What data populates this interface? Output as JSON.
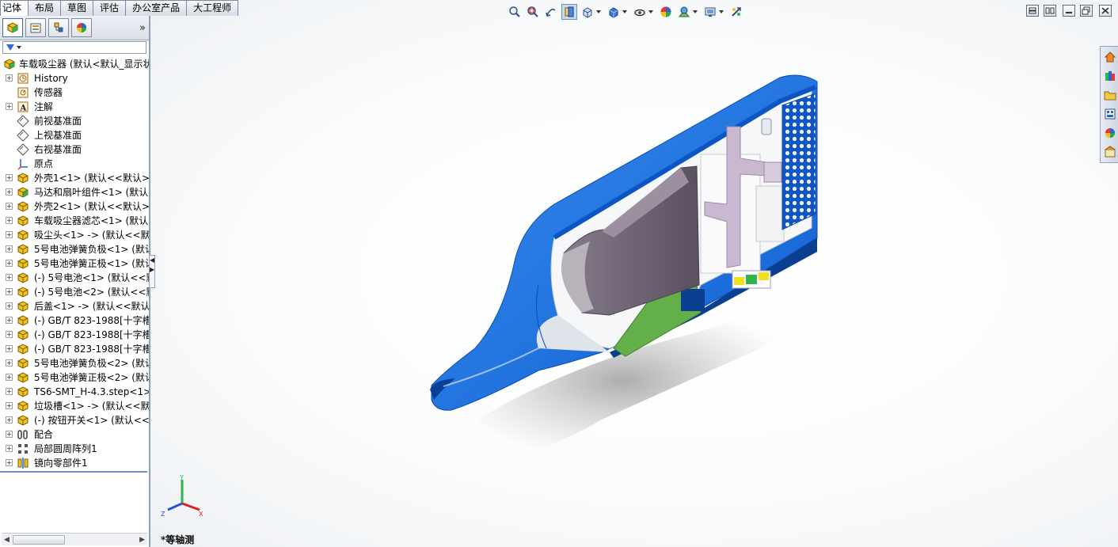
{
  "command_tabs": [
    {
      "label": "记体",
      "active": true
    },
    {
      "label": "布局",
      "active": false
    },
    {
      "label": "草图",
      "active": false
    },
    {
      "label": "评估",
      "active": false
    },
    {
      "label": "办公室产品",
      "active": false
    },
    {
      "label": "大工程师",
      "active": false
    }
  ],
  "panel": {
    "tabs": [
      "featuremanager-icon",
      "propertymanager-icon",
      "configurationmanager-icon",
      "displaymanager-icon"
    ],
    "expand_glyph": "»",
    "tree": [
      {
        "label": "车载吸尘器  (默认<默认_显示状",
        "icon": "assembly-icon",
        "top": true
      },
      {
        "label": "History",
        "icon": "history-icon",
        "expand": true
      },
      {
        "label": "传感器",
        "icon": "sensor-icon",
        "expand": false
      },
      {
        "label": "注解",
        "icon": "annotation-icon",
        "expand": true
      },
      {
        "label": "前视基准面",
        "icon": "plane-icon",
        "expand": false
      },
      {
        "label": "上视基准面",
        "icon": "plane-icon",
        "expand": false
      },
      {
        "label": "右视基准面",
        "icon": "plane-icon",
        "expand": false
      },
      {
        "label": "原点",
        "icon": "origin-icon",
        "expand": false
      },
      {
        "label": "外壳1<1> (默认<<默认>_",
        "icon": "part-icon",
        "expand": true
      },
      {
        "label": "马达和扇叶组件<1> (默认<",
        "icon": "subassembly-icon",
        "expand": true
      },
      {
        "label": "外壳2<1> (默认<<默认>_",
        "icon": "part-icon",
        "expand": true
      },
      {
        "label": "车载吸尘器滤芯<1> (默认<",
        "icon": "part-icon",
        "expand": true
      },
      {
        "label": "吸尘头<1> -> (默认<<默认",
        "icon": "part-icon",
        "expand": true
      },
      {
        "label": "5号电池弹簧负极<1> (默认",
        "icon": "part-icon",
        "expand": true
      },
      {
        "label": "5号电池弹簧正极<1> (默认",
        "icon": "part-icon",
        "expand": true
      },
      {
        "label": "(-) 5号电池<1> (默认<<默",
        "icon": "part-icon",
        "expand": true
      },
      {
        "label": "(-) 5号电池<2> (默认<<默",
        "icon": "part-icon",
        "expand": true
      },
      {
        "label": "后盖<1> -> (默认<<默认>",
        "icon": "part-icon",
        "expand": true
      },
      {
        "label": "(-) GB/T 823-1988[十字槽",
        "icon": "part-icon",
        "expand": true
      },
      {
        "label": "(-) GB/T 823-1988[十字槽",
        "icon": "part-icon",
        "expand": true
      },
      {
        "label": "(-) GB/T 823-1988[十字槽",
        "icon": "part-icon",
        "expand": true
      },
      {
        "label": "5号电池弹簧负极<2> (默认",
        "icon": "part-icon",
        "expand": true
      },
      {
        "label": "5号电池弹簧正极<2> (默认",
        "icon": "part-icon",
        "expand": true
      },
      {
        "label": "TS6-SMT_H-4.3.step<1>",
        "icon": "part-icon",
        "expand": true
      },
      {
        "label": "垃圾槽<1> -> (默认<<默认",
        "icon": "part-icon",
        "expand": true
      },
      {
        "label": "(-) 按钮开关<1> (默认<<默",
        "icon": "part-icon",
        "expand": true
      },
      {
        "label": "配合",
        "icon": "mates-icon",
        "expand": true
      },
      {
        "label": "局部圆周阵列1",
        "icon": "circular-pattern-icon",
        "expand": true
      },
      {
        "label": "镜向零部件1",
        "icon": "mirror-icon",
        "expand": true
      }
    ]
  },
  "hud_toolbar": [
    {
      "icon": "zoom-to-fit-icon",
      "dropdown": false,
      "active": false
    },
    {
      "icon": "zoom-to-area-icon",
      "dropdown": false,
      "active": false
    },
    {
      "icon": "previous-view-icon",
      "dropdown": false,
      "active": false
    },
    {
      "icon": "section-view-icon",
      "dropdown": false,
      "active": true
    },
    {
      "icon": "view-orientation-icon",
      "dropdown": true,
      "active": false
    },
    {
      "icon": "display-style-icon",
      "dropdown": true,
      "active": false
    },
    {
      "icon": "hide-show-items-icon",
      "dropdown": true,
      "active": false
    },
    {
      "icon": "edit-appearance-icon",
      "dropdown": false,
      "active": false
    },
    {
      "icon": "apply-scene-icon",
      "dropdown": true,
      "active": false
    },
    {
      "icon": "view-settings-icon",
      "dropdown": true,
      "active": false
    },
    {
      "icon": "rendering-icon",
      "dropdown": false,
      "active": false
    }
  ],
  "window_controls": [
    "tile-horizontal-icon",
    "tile-vertical-icon",
    "minimize-icon",
    "restore-icon",
    "close-icon"
  ],
  "task_pane": [
    "solidworks-resources-icon",
    "design-library-icon",
    "file-explorer-icon",
    "view-palette-icon",
    "appearances-icon",
    "custom-properties-icon"
  ],
  "view_label": "*等轴测",
  "triad_axes": [
    "Y",
    "X",
    "Z"
  ],
  "colors": {
    "housing_blue": "#1473e6",
    "housing_dark": "#0b3f8f",
    "component_mauve": "#6e6272",
    "component_lilac": "#c9b8d0",
    "pcb_green": "#63b04a",
    "accent_yellow": "#f0e020",
    "panel_border": "#8fa0b8"
  }
}
